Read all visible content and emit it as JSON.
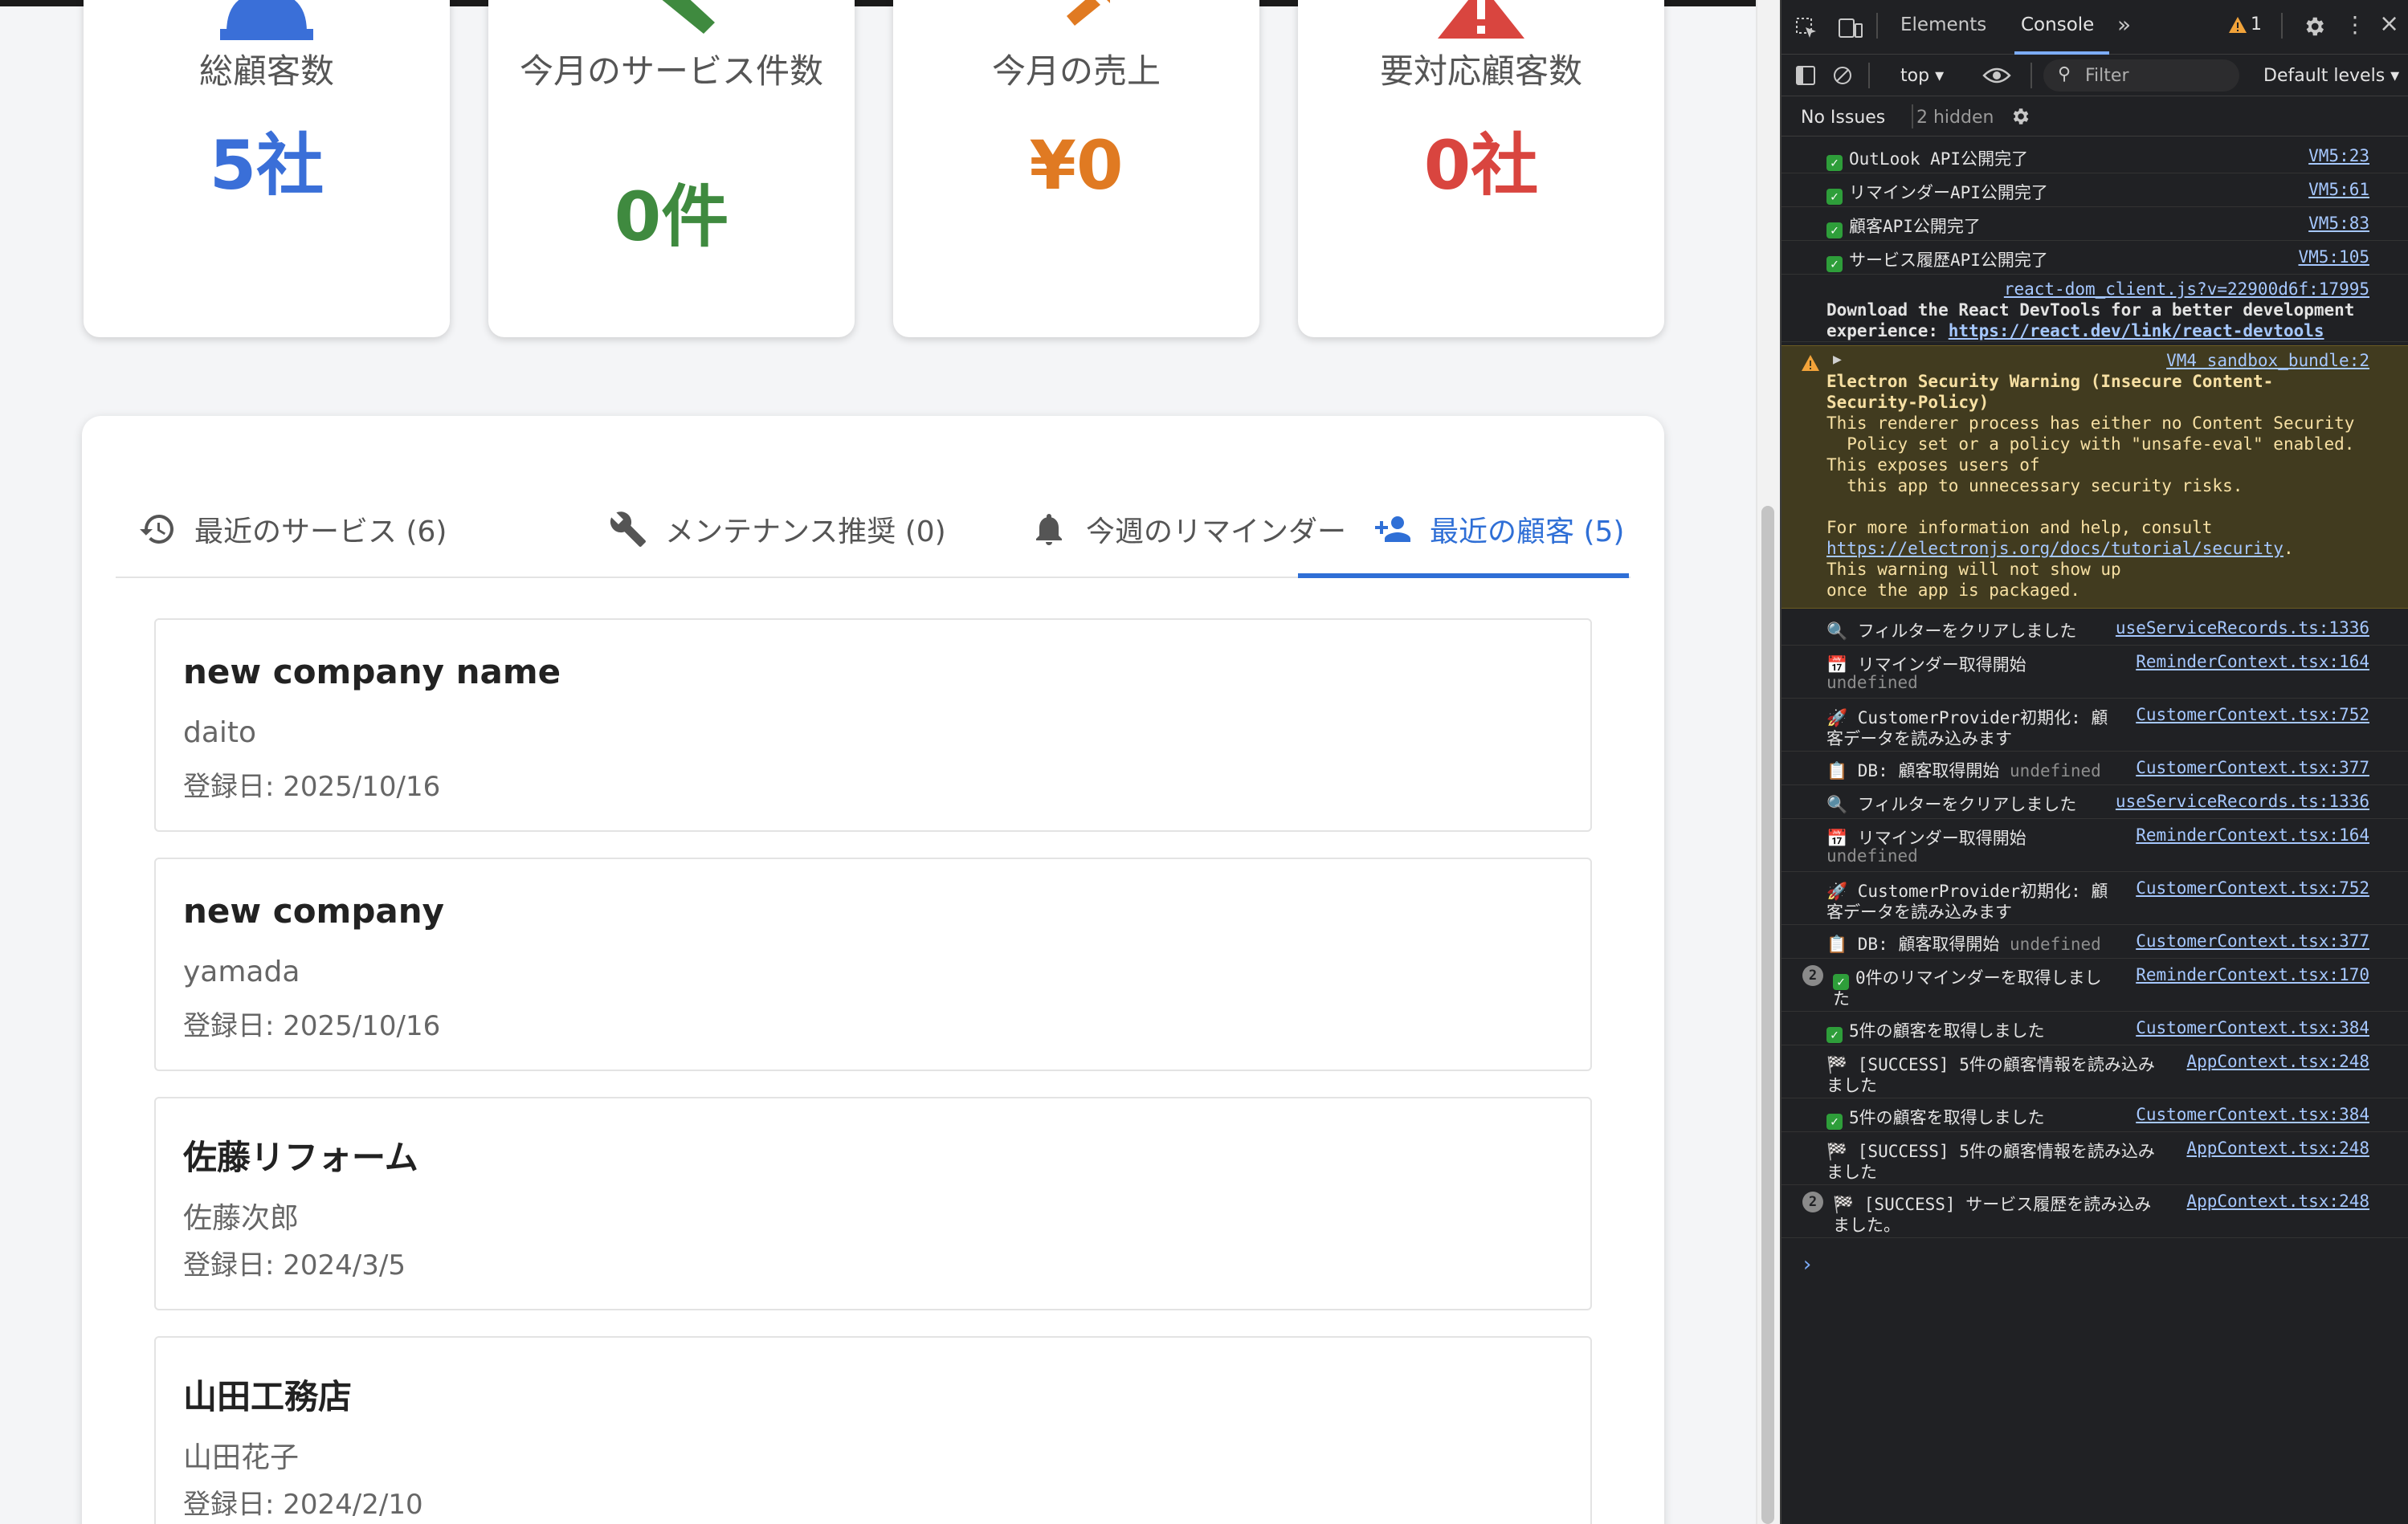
{
  "stats": [
    {
      "label": "総顧客数",
      "value": "5社",
      "color": "#3a6fd8"
    },
    {
      "label": "今月のサービス件数",
      "value": "0件",
      "color": "#3f8a3f"
    },
    {
      "label": "今月の売上",
      "value": "¥0",
      "color": "#e07a22"
    },
    {
      "label": "要対応顧客数",
      "value": "0社",
      "color": "#d9453f"
    }
  ],
  "tabs": [
    {
      "label": "最近のサービス (6)",
      "icon": "history-icon"
    },
    {
      "label": "メンテナンス推奨 (0)",
      "icon": "wrench-icon"
    },
    {
      "label": "今週のリマインダー",
      "icon": "bell-icon"
    },
    {
      "label": "最近の顧客 (5)",
      "icon": "person-add-icon",
      "active": true
    }
  ],
  "customers": [
    {
      "name": "new company name",
      "contact": "daito",
      "date": "登録日: 2025/10/16"
    },
    {
      "name": "new company",
      "contact": "yamada",
      "date": "登録日: 2025/10/16"
    },
    {
      "name": "佐藤リフォーム",
      "contact": "佐藤次郎",
      "date": "登録日: 2024/3/5"
    },
    {
      "name": "山田工務店",
      "contact": "山田花子",
      "date": "登録日: 2024/2/10"
    }
  ],
  "devtools": {
    "tabs": {
      "elements": "Elements",
      "console": "Console"
    },
    "warning_count": "1",
    "context": "top",
    "filter_placeholder": "Filter",
    "levels": "Default levels",
    "issues": "No Issues",
    "hidden": "2 hidden",
    "logs": [
      {
        "msg": "OutLook API公開完了",
        "src": "VM5:23",
        "check": true
      },
      {
        "msg": "リマインダーAPI公開完了",
        "src": "VM5:61",
        "check": true
      },
      {
        "msg": "顧客API公開完了",
        "src": "VM5:83",
        "check": true
      },
      {
        "msg": "サービス履歴API公開完了",
        "src": "VM5:105",
        "check": true
      },
      {
        "src": "react-dom_client.js?v=22900d6f:17995",
        "msg": "Download the React DevTools for a better development",
        "msg2": "experience: ",
        "link": "https://react.dev/link/react-devtools"
      },
      {
        "warn": true,
        "src": "VM4 sandbox_bundle:2",
        "title1": "Electron Security Warning (Insecure Content-",
        "title2": "Security-Policy)",
        "body": [
          "This renderer process has either no Content Security",
          "  Policy set or a policy with \"unsafe-eval\" enabled.",
          "This exposes users of",
          "  this app to unnecessary security risks.",
          "",
          "For more information and help, consult"
        ],
        "link": "https://electronjs.org/docs/tutorial/security",
        "tail": [
          "This warning will not show up",
          "once the app is packaged."
        ]
      },
      {
        "msg": "🔍 フィルターをクリアしました",
        "src": "useServiceRecords.ts:1336"
      },
      {
        "msg": "📅 リマインダー取得開始",
        "src": "ReminderContext.tsx:164",
        "extra": "undefined"
      },
      {
        "msg": "🚀 CustomerProvider初期化: 顧",
        "msg2": "客データを読み込みます",
        "src": "CustomerContext.tsx:752"
      },
      {
        "msg": "📋 DB: 顧客取得開始",
        "extra_inline": "undefined",
        "src": "CustomerContext.tsx:377"
      },
      {
        "msg": "🔍 フィルターをクリアしました",
        "src": "useServiceRecords.ts:1336"
      },
      {
        "msg": "📅 リマインダー取得開始",
        "src": "ReminderContext.tsx:164",
        "extra": "undefined"
      },
      {
        "msg": "🚀 CustomerProvider初期化: 顧",
        "msg2": "客データを読み込みます",
        "src": "CustomerContext.tsx:752"
      },
      {
        "msg": "📋 DB: 顧客取得開始",
        "extra_inline": "undefined",
        "src": "CustomerContext.tsx:377"
      },
      {
        "badge": "2",
        "msg": "0件のリマインダーを取得しまし",
        "msg2": "た",
        "src": "ReminderContext.tsx:170",
        "check": true
      },
      {
        "msg": "5件の顧客を取得しました",
        "src": "CustomerContext.tsx:384",
        "check": true
      },
      {
        "msg": "🏁 [SUCCESS] 5件の顧客情報を読み込み",
        "msg2": "ました",
        "src": "AppContext.tsx:248"
      },
      {
        "msg": "5件の顧客を取得しました",
        "src": "CustomerContext.tsx:384",
        "check": true
      },
      {
        "msg": "🏁 [SUCCESS] 5件の顧客情報を読み込み",
        "msg2": "ました",
        "src": "AppContext.tsx:248"
      },
      {
        "badge": "2",
        "msg": "🏁 [SUCCESS] サービス履歴を読み込み",
        "msg2": "ました。",
        "src": "AppContext.tsx:248"
      }
    ],
    "prompt": "›"
  }
}
